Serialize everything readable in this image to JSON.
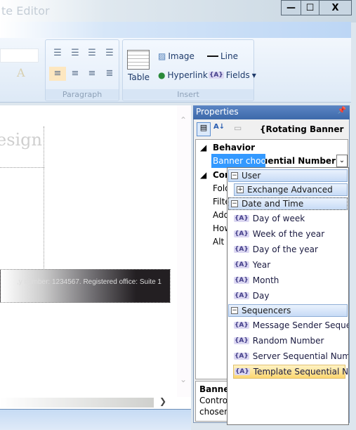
{
  "window": {
    "title": "te Editor",
    "controls": [
      "—",
      "☐",
      "X"
    ]
  },
  "ribbon": {
    "paragraph": {
      "label": "Paragraph"
    },
    "insert": {
      "label": "Insert",
      "table": "Table",
      "image": "Image",
      "line": "Line",
      "hyperlink": "Hyperlink",
      "fields": "Fields"
    }
  },
  "canvas": {
    "design_text": "esign",
    "banner_text": "y number: 1234567. Registered office: Suite 1,"
  },
  "properties": {
    "title": "Properties",
    "object": "{Rotating Banner ...",
    "categories": [
      {
        "name": "Behavior",
        "rows": [
          {
            "name": "Banner choose",
            "value": "equential Number"
          }
        ]
      },
      {
        "name": "Con",
        "rows": [
          {
            "name": "Fold"
          },
          {
            "name": "Filte"
          },
          {
            "name": "Add"
          },
          {
            "name": "How"
          },
          {
            "name": "Alt t"
          }
        ]
      }
    ],
    "desc_title": "Banner",
    "desc_line1": "Control",
    "desc_line2": "chosen"
  },
  "dropdown": {
    "user": "User",
    "exchange": "Exchange Advanced",
    "datetime": "Date and Time",
    "datetime_items": [
      "Day of week",
      "Week of the year",
      "Day of the year",
      "Year",
      "Month",
      "Day"
    ],
    "sequencers": "Sequencers",
    "sequencer_items": [
      "Message Sender Sequent...",
      "Random Number",
      "Server Sequential Number",
      "Template Sequential Nu..."
    ],
    "selected": "Template Sequential Nu...",
    "field_icon": "{A}"
  }
}
